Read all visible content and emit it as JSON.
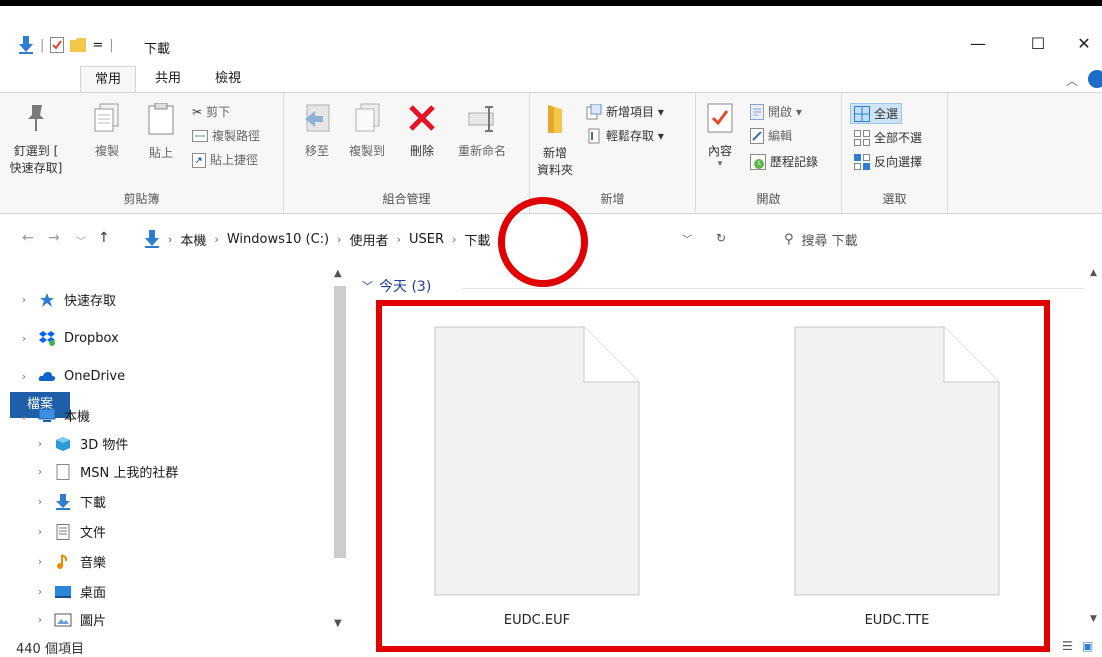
{
  "window": {
    "title": "下載",
    "quick_access_sep": "=",
    "minimize": "—",
    "maximize": "☐",
    "close": "✕"
  },
  "tabs": [
    {
      "label": "檔案"
    },
    {
      "label": "常用"
    },
    {
      "label": "共用"
    },
    {
      "label": "檢視"
    }
  ],
  "ribbon": {
    "clipboard": {
      "pin_line1": "釘選到 [",
      "pin_line2": "快速存取]",
      "copy": "複製",
      "paste": "貼上",
      "cut": "剪下",
      "copy_path": "複製路徑",
      "paste_shortcut": "貼上捷徑",
      "group_label": "剪貼簿"
    },
    "organize": {
      "move_to": "移至",
      "copy_to": "複製到",
      "delete": "刪除",
      "rename": "重新命名",
      "group_label": "組合管理"
    },
    "new": {
      "new_folder_line1": "新增",
      "new_folder_line2": "資料夾",
      "new_item": "新增項目 ▾",
      "easy_access": "輕鬆存取 ▾",
      "group_label": "新增"
    },
    "open": {
      "properties": "內容",
      "open": "開啟 ▾",
      "edit": "編輯",
      "history": "歷程記錄",
      "group_label": "開啟"
    },
    "select": {
      "select_all": "全選",
      "select_none": "全部不選",
      "invert": "反向選擇",
      "group_label": "選取"
    }
  },
  "address": {
    "crumbs": [
      "本機",
      "Windows10 (C:)",
      "使用者",
      "USER",
      "下載"
    ],
    "search_placeholder": "搜尋 下載"
  },
  "nav_pane": {
    "items": [
      {
        "label": "快速存取"
      },
      {
        "label": "Dropbox"
      },
      {
        "label": "OneDrive"
      },
      {
        "label": "本機"
      },
      {
        "label": "3D 物件"
      },
      {
        "label": "MSN 上我的社群"
      },
      {
        "label": "下載"
      },
      {
        "label": "文件"
      },
      {
        "label": "音樂"
      },
      {
        "label": "桌面"
      },
      {
        "label": "圖片"
      }
    ]
  },
  "content": {
    "group_header": "今天 (3)",
    "files": [
      {
        "name": "EUDC.EUF"
      },
      {
        "name": "EUDC.TTE"
      }
    ]
  },
  "status": {
    "item_count": "440 個項目"
  },
  "colors": {
    "annotation_red": "#e00000",
    "file_tab_blue": "#1e5fa8",
    "group_header_blue": "#1e3c9c"
  }
}
